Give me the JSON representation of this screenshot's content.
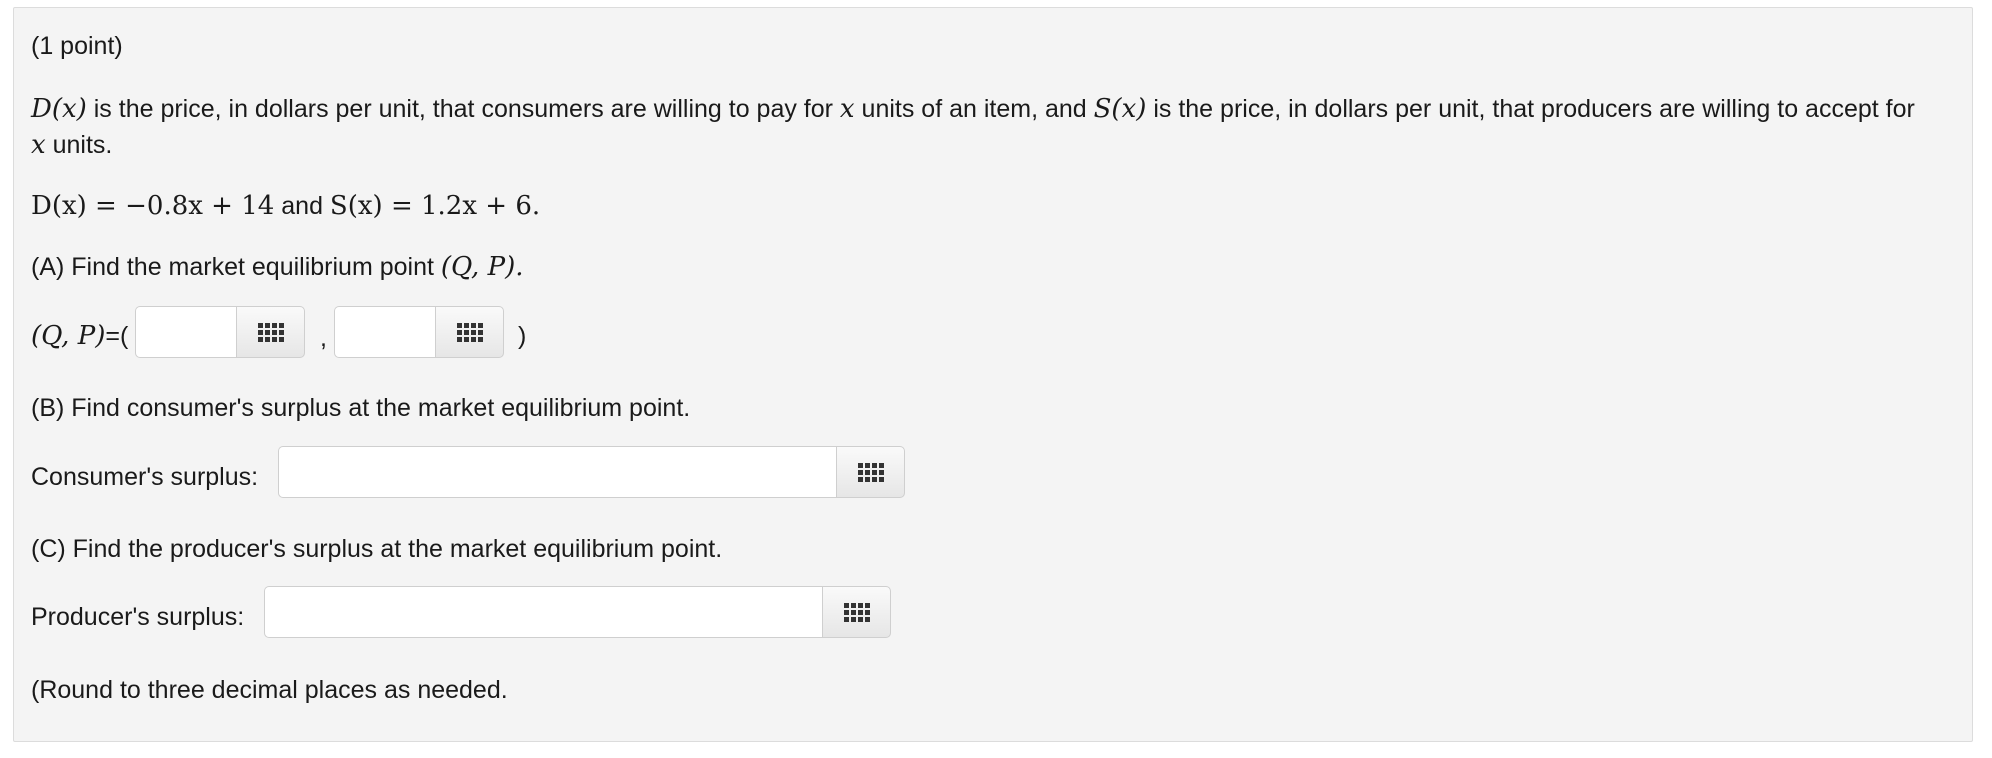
{
  "header": {
    "points": "(1 point)"
  },
  "intro": {
    "d_of_x": "D(x)",
    "text1": " is the price, in dollars per unit, that consumers are willing to pay for ",
    "x1": "x",
    "text2": " units of an item, and ",
    "s_of_x": "S(x)",
    "text3": " is the price, in dollars per unit, that producers are willing to accept for",
    "x2": "x",
    "text4": " units."
  },
  "equations": {
    "demand": "D(x) = −0.8x + 14",
    "connector": " and ",
    "supply": "S(x) = 1.2x + 6."
  },
  "part_a": {
    "question": "(A) Find the market equilibrium point ",
    "question_math": "(Q, P).",
    "answer_label_math": "(Q, P)",
    "answer_label_open": "=(",
    "separator": ",",
    "close_paren": ")",
    "q_value": "",
    "p_value": ""
  },
  "part_b": {
    "question": "(B) Find consumer's surplus at the market equilibrium point.",
    "label": "Consumer's surplus:",
    "value": ""
  },
  "part_c": {
    "question": "(C) Find the producer's surplus at the market equilibrium point.",
    "label": "Producer's surplus:",
    "value": ""
  },
  "footer": {
    "note": "(Round to three decimal places as needed."
  },
  "icons": {
    "keyboard": "keyboard-icon"
  }
}
